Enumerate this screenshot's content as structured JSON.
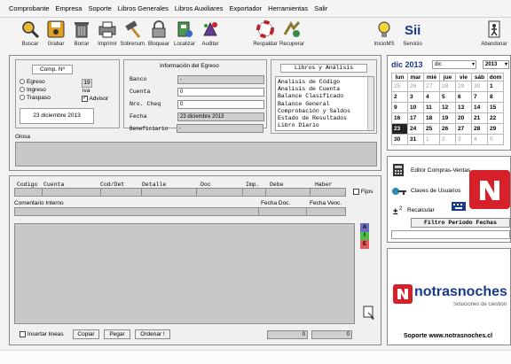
{
  "menu": [
    "Comprobante",
    "Empresa",
    "Soporte",
    "Libros Generales",
    "Libros Auxiliares",
    "Exportador",
    "Herramientas",
    "Salir"
  ],
  "toolbar": {
    "buscar": "Buscar",
    "grabar": "Grabar",
    "borrar": "Borrar",
    "imprimir": "Imprimir",
    "sobrenum": "Sobrenum.",
    "bloquear": "Bloquear",
    "localizar": "Localizar",
    "auditar": "Auditar",
    "respaldar": "Respaldar",
    "recuperar": "Recuperar",
    "iniciams": "InicioMS",
    "servicio": "Servicio",
    "abandonar": "Abandonar"
  },
  "comp": {
    "title": "Comp. Nº",
    "egreso": "Egreso",
    "ingreso": "Ingreso",
    "traspaso": "Traspaso",
    "num": "19",
    "iva": "iva",
    "advisor": "Advisor",
    "date": "23 diciembre 2013"
  },
  "info": {
    "title": "Información del Egreso",
    "banco": "Banco",
    "banco_val": "-",
    "cuenta": "Cuenta",
    "cuenta_val": "0",
    "cheq": "Nro. Cheq",
    "cheq_val": "0",
    "fecha": "Fecha",
    "fecha_val": "23 diciembre 2013",
    "beneficiario": "Beneficiario",
    "beneficiario_val": "-"
  },
  "libros": {
    "title": "Libros y Análisis",
    "items": [
      "Analisis de Código",
      "Analisis de Cuenta",
      "Balance Clasificado",
      "Balance General",
      "Comprobación y Saldos",
      "Estado de Resultados",
      "Libro Diario"
    ]
  },
  "glosa": "Glosa",
  "calendar": {
    "title": "dic 2013",
    "month_sel": "dic",
    "year_sel": "2013",
    "days": [
      "lun",
      "mar",
      "mié",
      "jue",
      "vie",
      "sáb",
      "dom"
    ],
    "rows": [
      [
        [
          "25",
          1
        ],
        [
          "26",
          1
        ],
        [
          "27",
          1
        ],
        [
          "28",
          1
        ],
        [
          "29",
          1
        ],
        [
          "30",
          1
        ],
        [
          "1",
          0
        ]
      ],
      [
        [
          "2",
          0
        ],
        [
          "3",
          0
        ],
        [
          "4",
          0
        ],
        [
          "5",
          0
        ],
        [
          "6",
          0
        ],
        [
          "7",
          0
        ],
        [
          "8",
          0
        ]
      ],
      [
        [
          "9",
          0
        ],
        [
          "10",
          0
        ],
        [
          "11",
          0
        ],
        [
          "12",
          0
        ],
        [
          "13",
          0
        ],
        [
          "14",
          0
        ],
        [
          "15",
          0
        ]
      ],
      [
        [
          "16",
          0
        ],
        [
          "17",
          0
        ],
        [
          "18",
          0
        ],
        [
          "19",
          0
        ],
        [
          "20",
          0
        ],
        [
          "21",
          0
        ],
        [
          "22",
          0
        ]
      ],
      [
        [
          "23",
          2
        ],
        [
          "24",
          0
        ],
        [
          "25",
          0
        ],
        [
          "26",
          0
        ],
        [
          "27",
          0
        ],
        [
          "28",
          0
        ],
        [
          "29",
          0
        ]
      ],
      [
        [
          "30",
          0
        ],
        [
          "31",
          0
        ],
        [
          "1",
          1
        ],
        [
          "2",
          1
        ],
        [
          "3",
          1
        ],
        [
          "4",
          1
        ],
        [
          "5",
          1
        ]
      ]
    ]
  },
  "tools": {
    "editor": "Editor Compras-Ventas",
    "claves": "Claves de Usuarios",
    "recalcular": "Recalcular",
    "filtro": "Filtro Periodo Fechas"
  },
  "grid": {
    "codigo": "Codigo",
    "cuenta": "Cuenta",
    "codet": "Cod/Det",
    "detalle": "Detalle",
    "doc": "Doc",
    "imp": "Imp.",
    "debe": "Debe",
    "haber": "Haber",
    "fijos": "Fijos",
    "comentario": "Comentario Interno",
    "fechadoc": "Fecha Doc.",
    "fechavenc": "Fecha Venc."
  },
  "side_btns": [
    "A",
    "I",
    "E"
  ],
  "bottom": {
    "insertar": "Insertar lineas",
    "copiar": "Copiar",
    "pegar": "Pegar",
    "ordenar": "Ordenar !",
    "debe_total": "0",
    "haber_total": "0"
  },
  "brand": {
    "name": "notrasnoches",
    "tag": "Soluciones de Gestión",
    "support": "Soporte www.notrasnoches.cl"
  },
  "colors": {
    "brand_red": "#d6202a",
    "accent_blue": "#1a3a8a"
  }
}
